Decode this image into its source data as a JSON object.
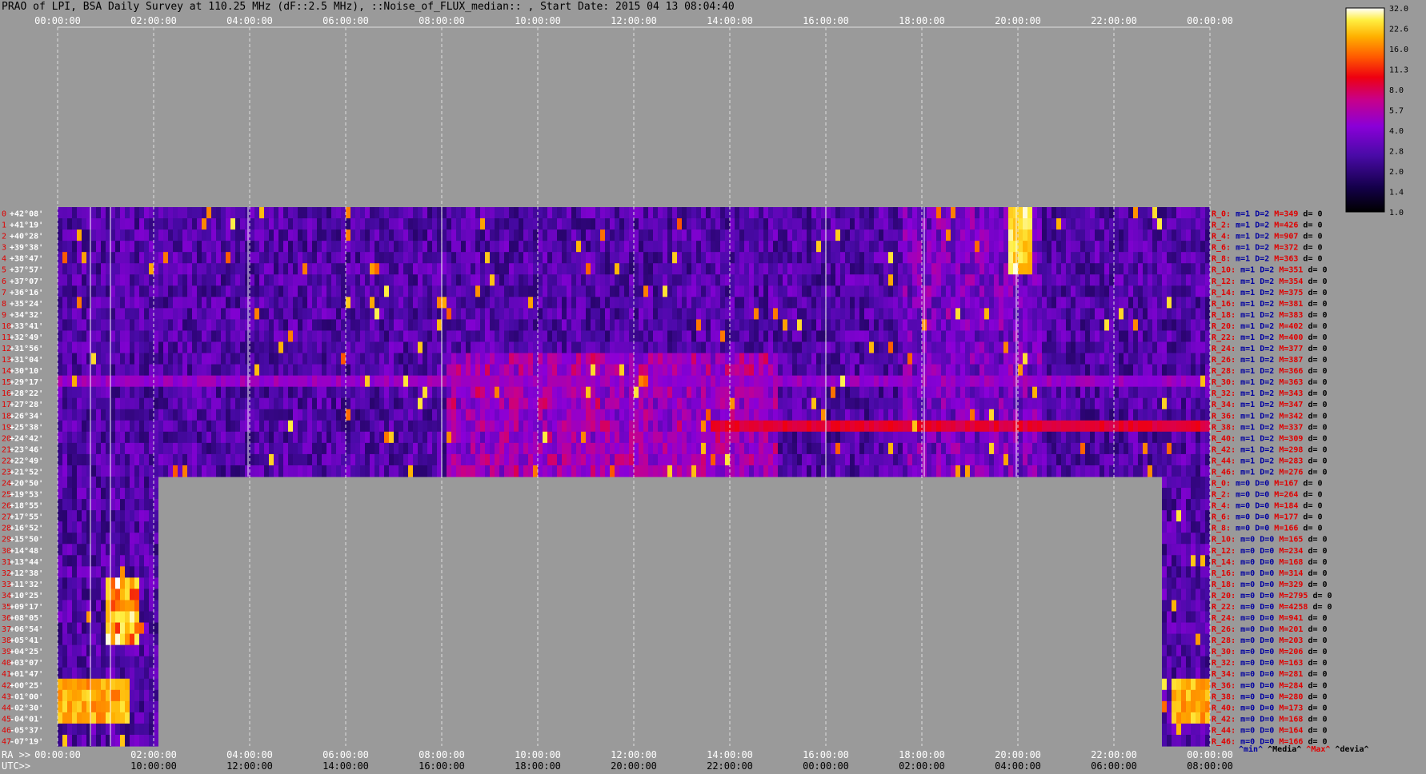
{
  "title": "PRAO of LPI, BSA Daily Survey at 110.25 MHz (dF::2.5 MHz), ::Noise_of_FLUX_median:: , Start Date: 2015 04 13 08:04:40",
  "colors": {
    "background": "#9a9a9a",
    "row_label": "#e00000",
    "stat_blue": "#0000a0",
    "stat_red": "#e00000"
  },
  "chart_data": {
    "type": "heatmap",
    "top_axis_ticks": [
      "00:00:00",
      "02:00:00",
      "04:00:00",
      "06:00:00",
      "08:00:00",
      "10:00:00",
      "12:00:00",
      "14:00:00",
      "16:00:00",
      "18:00:00",
      "20:00:00",
      "22:00:00",
      "00:00:00"
    ],
    "bottom_axis_prefix": "RA >>",
    "bottom_axis_ticks": [
      "00:00:00",
      "02:00:00",
      "04:00:00",
      "06:00:00",
      "08:00:00",
      "10:00:00",
      "12:00:00",
      "14:00:00",
      "16:00:00",
      "18:00:00",
      "20:00:00",
      "22:00:00",
      "00:00:00"
    ],
    "utc_prefix": "UTC>>",
    "utc_ticks": [
      "10:00:00",
      "12:00:00",
      "14:00:00",
      "16:00:00",
      "18:00:00",
      "20:00:00",
      "22:00:00",
      "00:00:00",
      "02:00:00",
      "04:00:00",
      "06:00:00",
      "08:00:00"
    ],
    "colorbar_ticks": [
      "32.0",
      "22.6",
      "16.0",
      "11.3",
      "8.0",
      "5.7",
      "4.0",
      "2.8",
      "2.0",
      "1.4",
      "1.0"
    ],
    "colorbar_scale": "log",
    "declinations": [
      "+42°08'",
      "+41°19'",
      "+40°28'",
      "+39°38'",
      "+38°47'",
      "+37°57'",
      "+37°07'",
      "+36°16'",
      "+35°24'",
      "+34°32'",
      "+33°41'",
      "+32°49'",
      "+31°56'",
      "+31°04'",
      "+30°10'",
      "+29°17'",
      "+28°22'",
      "+27°28'",
      "+26°34'",
      "+25°38'",
      "+24°42'",
      "+23°46'",
      "+22°49'",
      "+21°52'",
      "+20°50'",
      "+19°53'",
      "+18°55'",
      "+17°55'",
      "+16°52'",
      "+15°50'",
      "+14°48'",
      "+13°44'",
      "+12°38'",
      "+11°32'",
      "+10°25'",
      "+09°17'",
      "+08°05'",
      "+06°54'",
      "+05°41'",
      "+04°25'",
      "+03°07'",
      "+01°47'",
      "+00°25'",
      "-01°00'",
      "-02°30'",
      "-04°01'",
      "-05°37'",
      "-07°19'"
    ],
    "row_indices": [
      "0",
      "1",
      "2",
      "3",
      "4",
      "5",
      "6",
      "7",
      "8",
      "9",
      "10",
      "11",
      "12",
      "13",
      "14",
      "15",
      "16",
      "17",
      "18",
      "19",
      "20",
      "21",
      "22",
      "23",
      "24",
      "25",
      "26",
      "27",
      "28",
      "29",
      "30",
      "31",
      "32",
      "33",
      "34",
      "35",
      "36",
      "37",
      "38",
      "39",
      "40",
      "41",
      "42",
      "43",
      "44",
      "45",
      "46",
      "47"
    ],
    "stats_rows": [
      {
        "r": "R_0:",
        "m": "m=1",
        "d": "D=2",
        "M": "M=349",
        "dev": "d= 0"
      },
      {
        "r": "R_2:",
        "m": "m=1",
        "d": "D=2",
        "M": "M=426",
        "dev": "d= 0"
      },
      {
        "r": "R_4:",
        "m": "m=1",
        "d": "D=2",
        "M": "M=907",
        "dev": "d= 0"
      },
      {
        "r": "R_6:",
        "m": "m=1",
        "d": "D=2",
        "M": "M=372",
        "dev": "d= 0"
      },
      {
        "r": "R_8:",
        "m": "m=1",
        "d": "D=2",
        "M": "M=363",
        "dev": "d= 0"
      },
      {
        "r": "R_10:",
        "m": "m=1",
        "d": "D=2",
        "M": "M=351",
        "dev": "d= 0"
      },
      {
        "r": "R_12:",
        "m": "m=1",
        "d": "D=2",
        "M": "M=354",
        "dev": "d= 0"
      },
      {
        "r": "R_14:",
        "m": "m=1",
        "d": "D=2",
        "M": "M=375",
        "dev": "d= 0"
      },
      {
        "r": "R_16:",
        "m": "m=1",
        "d": "D=2",
        "M": "M=381",
        "dev": "d= 0"
      },
      {
        "r": "R_18:",
        "m": "m=1",
        "d": "D=2",
        "M": "M=383",
        "dev": "d= 0"
      },
      {
        "r": "R_20:",
        "m": "m=1",
        "d": "D=2",
        "M": "M=402",
        "dev": "d= 0"
      },
      {
        "r": "R_22:",
        "m": "m=1",
        "d": "D=2",
        "M": "M=400",
        "dev": "d= 0"
      },
      {
        "r": "R_24:",
        "m": "m=1",
        "d": "D=2",
        "M": "M=377",
        "dev": "d= 0"
      },
      {
        "r": "R_26:",
        "m": "m=1",
        "d": "D=2",
        "M": "M=387",
        "dev": "d= 0"
      },
      {
        "r": "R_28:",
        "m": "m=1",
        "d": "D=2",
        "M": "M=366",
        "dev": "d= 0"
      },
      {
        "r": "R_30:",
        "m": "m=1",
        "d": "D=2",
        "M": "M=363",
        "dev": "d= 0"
      },
      {
        "r": "R_32:",
        "m": "m=1",
        "d": "D=2",
        "M": "M=343",
        "dev": "d= 0"
      },
      {
        "r": "R_34:",
        "m": "m=1",
        "d": "D=2",
        "M": "M=347",
        "dev": "d= 0"
      },
      {
        "r": "R_36:",
        "m": "m=1",
        "d": "D=2",
        "M": "M=342",
        "dev": "d= 0"
      },
      {
        "r": "R_38:",
        "m": "m=1",
        "d": "D=2",
        "M": "M=337",
        "dev": "d= 0"
      },
      {
        "r": "R_40:",
        "m": "m=1",
        "d": "D=2",
        "M": "M=309",
        "dev": "d= 0"
      },
      {
        "r": "R_42:",
        "m": "m=1",
        "d": "D=2",
        "M": "M=298",
        "dev": "d= 0"
      },
      {
        "r": "R_44:",
        "m": "m=1",
        "d": "D=2",
        "M": "M=283",
        "dev": "d= 0"
      },
      {
        "r": "R_46:",
        "m": "m=1",
        "d": "D=2",
        "M": "M=276",
        "dev": "d= 0"
      },
      {
        "r": "R_0:",
        "m": "m=0",
        "d": "D=0",
        "M": "M=167",
        "dev": "d= 0"
      },
      {
        "r": "R_2:",
        "m": "m=0",
        "d": "D=0",
        "M": "M=264",
        "dev": "d= 0"
      },
      {
        "r": "R_4:",
        "m": "m=0",
        "d": "D=0",
        "M": "M=184",
        "dev": "d= 0"
      },
      {
        "r": "R_6:",
        "m": "m=0",
        "d": "D=0",
        "M": "M=177",
        "dev": "d= 0"
      },
      {
        "r": "R_8:",
        "m": "m=0",
        "d": "D=0",
        "M": "M=166",
        "dev": "d= 0"
      },
      {
        "r": "R_10:",
        "m": "m=0",
        "d": "D=0",
        "M": "M=165",
        "dev": "d= 0"
      },
      {
        "r": "R_12:",
        "m": "m=0",
        "d": "D=0",
        "M": "M=234",
        "dev": "d= 0"
      },
      {
        "r": "R_14:",
        "m": "m=0",
        "d": "D=0",
        "M": "M=168",
        "dev": "d= 0"
      },
      {
        "r": "R_16:",
        "m": "m=0",
        "d": "D=0",
        "M": "M=314",
        "dev": "d= 0"
      },
      {
        "r": "R_18:",
        "m": "m=0",
        "d": "D=0",
        "M": "M=329",
        "dev": "d= 0"
      },
      {
        "r": "R_20:",
        "m": "m=0",
        "d": "D=0",
        "M": "M=2795",
        "dev": "d= 0"
      },
      {
        "r": "R_22:",
        "m": "m=0",
        "d": "D=0",
        "M": "M=4258",
        "dev": "d= 0"
      },
      {
        "r": "R_24:",
        "m": "m=0",
        "d": "D=0",
        "M": "M=941",
        "dev": "d= 0"
      },
      {
        "r": "R_26:",
        "m": "m=0",
        "d": "D=0",
        "M": "M=201",
        "dev": "d= 0"
      },
      {
        "r": "R_28:",
        "m": "m=0",
        "d": "D=0",
        "M": "M=203",
        "dev": "d= 0"
      },
      {
        "r": "R_30:",
        "m": "m=0",
        "d": "D=0",
        "M": "M=206",
        "dev": "d= 0"
      },
      {
        "r": "R_32:",
        "m": "m=0",
        "d": "D=0",
        "M": "M=163",
        "dev": "d= 0"
      },
      {
        "r": "R_34:",
        "m": "m=0",
        "d": "D=0",
        "M": "M=281",
        "dev": "d= 0"
      },
      {
        "r": "R_36:",
        "m": "m=0",
        "d": "D=0",
        "M": "M=284",
        "dev": "d= 0"
      },
      {
        "r": "R_38:",
        "m": "m=0",
        "d": "D=0",
        "M": "M=280",
        "dev": "d= 0"
      },
      {
        "r": "R_40:",
        "m": "m=0",
        "d": "D=0",
        "M": "M=173",
        "dev": "d= 0"
      },
      {
        "r": "R_42:",
        "m": "m=0",
        "d": "D=0",
        "M": "M=168",
        "dev": "d= 0"
      },
      {
        "r": "R_44:",
        "m": "m=0",
        "d": "D=0",
        "M": "M=164",
        "dev": "d= 0"
      },
      {
        "r": "R_46:",
        "m": "m=0",
        "d": "D=0",
        "M": "M=166",
        "dev": "d= 0"
      }
    ],
    "stats_footer": {
      "min": "^min^",
      "median": "^Media^",
      "max": "^Max^",
      "dev": "^devia^"
    }
  }
}
